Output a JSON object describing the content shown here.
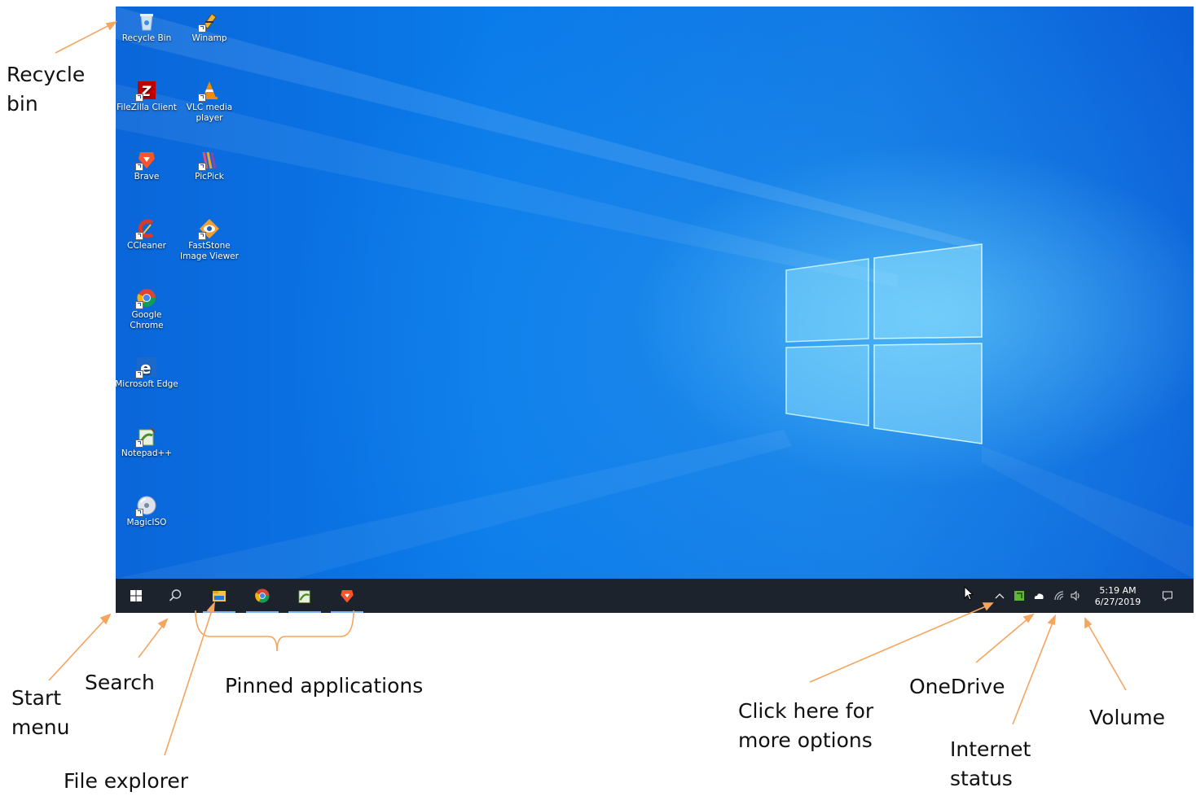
{
  "desktop": {
    "icons": [
      {
        "label": "Recycle Bin",
        "icon": "recycle-bin-icon"
      },
      {
        "label": "Winamp",
        "icon": "winamp-icon"
      },
      {
        "label": "FileZilla Client",
        "icon": "filezilla-icon"
      },
      {
        "label": "VLC media player",
        "icon": "vlc-icon"
      },
      {
        "label": "Brave",
        "icon": "brave-icon"
      },
      {
        "label": "PicPick",
        "icon": "picpick-icon"
      },
      {
        "label": "CCleaner",
        "icon": "ccleaner-icon"
      },
      {
        "label": "FastStone Image Viewer",
        "icon": "faststone-icon"
      },
      {
        "label": "Google Chrome",
        "icon": "chrome-icon"
      },
      {
        "label": "Microsoft Edge",
        "icon": "edge-icon"
      },
      {
        "label": "Notepad++",
        "icon": "notepadpp-icon"
      },
      {
        "label": "MagicISO",
        "icon": "magiciso-icon"
      }
    ]
  },
  "taskbar": {
    "start_icon": "windows-start-icon",
    "search_icon": "search-icon",
    "pinned": [
      {
        "name": "File Explorer",
        "icon": "file-explorer-icon"
      },
      {
        "name": "Google Chrome",
        "icon": "chrome-icon"
      },
      {
        "name": "Notepad++",
        "icon": "notepadpp-icon"
      },
      {
        "name": "Brave",
        "icon": "brave-icon"
      }
    ],
    "tray": {
      "time": "5:19 AM",
      "date": "6/27/2019",
      "icons": [
        "chevron-up-icon",
        "app-tray-icon",
        "onedrive-cloud-icon",
        "wifi-icon",
        "volume-icon",
        "notification-icon"
      ]
    }
  },
  "annotations": {
    "recycle_bin": "Recycle bin",
    "start_menu": "Start menu",
    "search": "Search",
    "pinned_applications": "Pinned applications",
    "file_explorer": "File explorer",
    "more_options": "Click here for more options",
    "onedrive": "OneDrive",
    "internet_status": "Internet status",
    "volume": "Volume"
  },
  "colors": {
    "wallpaper": "#0a78e6",
    "taskbar": "#1d232d",
    "annotation_arrow": "#f4a55e"
  }
}
